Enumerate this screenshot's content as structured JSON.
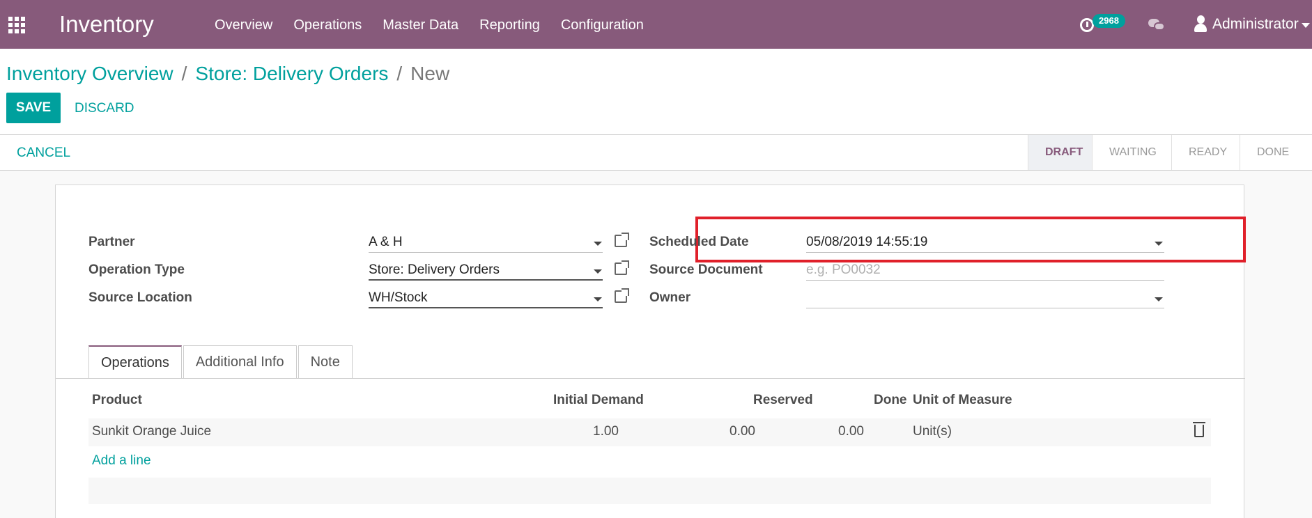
{
  "navbar": {
    "brand": "Inventory",
    "menu": [
      "Overview",
      "Operations",
      "Master Data",
      "Reporting",
      "Configuration"
    ],
    "activity_count": "2968",
    "user": "Administrator"
  },
  "breadcrumb": {
    "items": [
      "Inventory Overview",
      "Store: Delivery Orders"
    ],
    "current": "New",
    "separator": "/"
  },
  "buttons": {
    "save": "SAVE",
    "discard": "DISCARD",
    "cancel": "CANCEL"
  },
  "stages": [
    "DRAFT",
    "WAITING",
    "READY",
    "DONE"
  ],
  "active_stage": "DRAFT",
  "form": {
    "left": [
      {
        "label": "Partner",
        "value": "A & H"
      },
      {
        "label": "Operation Type",
        "value": "Store: Delivery Orders"
      },
      {
        "label": "Source Location",
        "value": "WH/Stock"
      }
    ],
    "right": [
      {
        "label": "Scheduled Date",
        "value": "05/08/2019 14:55:19"
      },
      {
        "label": "Source Document",
        "placeholder": "e.g. PO0032"
      },
      {
        "label": "Owner",
        "value": ""
      }
    ]
  },
  "tabs": [
    "Operations",
    "Additional Info",
    "Note"
  ],
  "active_tab": "Operations",
  "table": {
    "headers": [
      "Product",
      "Initial Demand",
      "Reserved",
      "Done",
      "Unit of Measure"
    ],
    "rows": [
      [
        "Sunkit Orange Juice",
        "1.00",
        "0.00",
        "0.00",
        "Unit(s)"
      ]
    ],
    "add_line": "Add a line"
  },
  "colors": {
    "brand": "#875a7b",
    "accent": "#00a09d",
    "highlight": "#e0202a"
  },
  "icons": {
    "apps": "apps-grid-icon",
    "activity": "clock-activity-icon",
    "chat": "chat-bubbles-icon",
    "user": "user-icon",
    "external": "external-link-icon",
    "dropdown": "caret-down-icon",
    "delete": "trash-icon"
  }
}
